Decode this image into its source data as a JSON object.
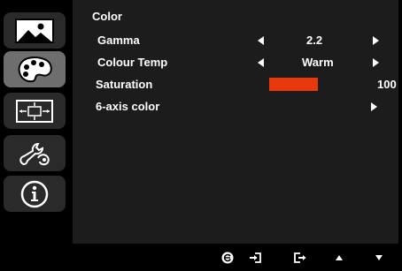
{
  "sidebar": {
    "items": [
      {
        "name": "picture-icon",
        "active": false
      },
      {
        "name": "color-palette-icon",
        "active": true
      },
      {
        "name": "osd-position-icon",
        "active": false
      },
      {
        "name": "settings-wrench-icon",
        "active": false
      },
      {
        "name": "information-icon",
        "active": false
      }
    ]
  },
  "menu": {
    "title": "Color",
    "gamma": {
      "label": "Gamma",
      "value": "2.2"
    },
    "colour_temp": {
      "label": "Colour Temp",
      "value": "Warm"
    },
    "saturation": {
      "label": "Saturation",
      "value": "100",
      "level_percent": 100
    },
    "six_axis": {
      "label": "6-axis color"
    }
  },
  "hints": [
    "reset-icon",
    "input-icon",
    "exit-icon",
    "up-arrow-icon",
    "down-arrow-icon"
  ],
  "colors": {
    "background": "#000000",
    "panel": "#1c1c1c",
    "active_tab": "#6e6e6e",
    "inactive_tab": "#2a2a2a",
    "saturation_bar": "#e8390e",
    "text": "#ffffff"
  }
}
